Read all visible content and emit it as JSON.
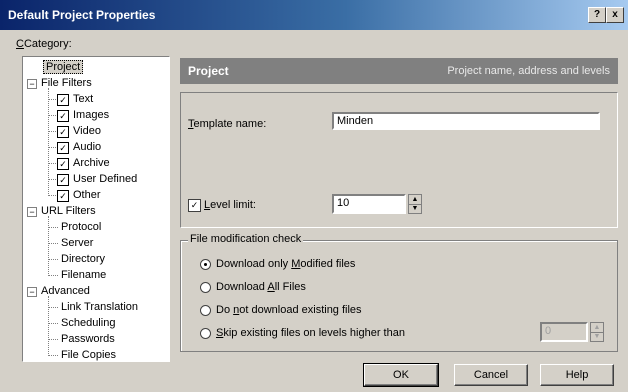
{
  "window": {
    "title": "Default Project Properties",
    "help_btn": "?",
    "close_btn": "x"
  },
  "category_label": "Category:",
  "tree": [
    {
      "label": "Project",
      "level": 0,
      "selected": true
    },
    {
      "label": "File Filters",
      "level": 0,
      "expand": "−"
    },
    {
      "label": "Text",
      "level": 1,
      "check": "✓"
    },
    {
      "label": "Images",
      "level": 1,
      "check": "✓"
    },
    {
      "label": "Video",
      "level": 1,
      "check": "✓"
    },
    {
      "label": "Audio",
      "level": 1,
      "check": "✓"
    },
    {
      "label": "Archive",
      "level": 1,
      "check": "✓"
    },
    {
      "label": "User Defined",
      "level": 1,
      "check": "✓"
    },
    {
      "label": "Other",
      "level": 1,
      "check": "✓"
    },
    {
      "label": "URL Filters",
      "level": 0,
      "expand": "−"
    },
    {
      "label": "Protocol",
      "level": 1
    },
    {
      "label": "Server",
      "level": 1
    },
    {
      "label": "Directory",
      "level": 1
    },
    {
      "label": "Filename",
      "level": 1
    },
    {
      "label": "Advanced",
      "level": 0,
      "expand": "−"
    },
    {
      "label": "Link Translation",
      "level": 1
    },
    {
      "label": "Scheduling",
      "level": 1
    },
    {
      "label": "Passwords",
      "level": 1
    },
    {
      "label": "File Copies",
      "level": 1
    }
  ],
  "header": {
    "title": "Project",
    "subtitle": "Project name, address and levels"
  },
  "template": {
    "label_u": "T",
    "label_rest": "emplate name:",
    "value": "Minden"
  },
  "level": {
    "checked_mark": "✓",
    "label_u": "L",
    "label_rest": "evel limit:",
    "value": "10"
  },
  "spin": {
    "up": "▲",
    "down": "▼"
  },
  "modcheck": {
    "legend": "File modification check",
    "options": [
      {
        "a": "Download only ",
        "u": "M",
        "b": "odified files",
        "selected": true
      },
      {
        "a": "Download ",
        "u": "A",
        "b": "ll Files",
        "selected": false
      },
      {
        "a": "Do ",
        "u": "n",
        "b": "ot download existing files",
        "selected": false
      },
      {
        "a": "",
        "u": "S",
        "b": "kip existing files on levels higher than",
        "selected": false
      }
    ],
    "skip_value": "0"
  },
  "buttons": {
    "ok": "OK",
    "cancel": "Cancel",
    "help": "Help"
  }
}
